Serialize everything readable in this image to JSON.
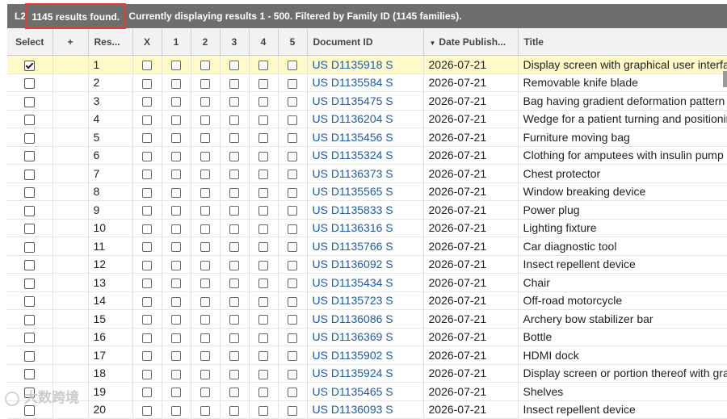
{
  "status": {
    "prefix": "L2",
    "count_text": "1145 results found.",
    "rest_text": " Currently displaying results 1 - 500. Filtered by Family ID (1145 families)."
  },
  "columns": {
    "select": "Select",
    "plus": "+",
    "result": "Res...",
    "x": "X",
    "c1": "1",
    "c2": "2",
    "c3": "3",
    "c4": "4",
    "c5": "5",
    "document_id": "Document ID",
    "date": "Date Publish...",
    "title": "Title"
  },
  "sort_icon": "sort-descending-triangle",
  "rows": [
    {
      "n": "1",
      "doc": "US D1135918 S",
      "date": "2026-07-21",
      "title": "Display screen with graphical user interface",
      "checked": true
    },
    {
      "n": "2",
      "doc": "US D1135584 S",
      "date": "2026-07-21",
      "title": "Removable knife blade",
      "checked": false
    },
    {
      "n": "3",
      "doc": "US D1135475 S",
      "date": "2026-07-21",
      "title": "Bag having gradient deformation pattern",
      "checked": false
    },
    {
      "n": "4",
      "doc": "US D1136204 S",
      "date": "2026-07-21",
      "title": "Wedge for a patient turning and positioning",
      "checked": false
    },
    {
      "n": "5",
      "doc": "US D1135456 S",
      "date": "2026-07-21",
      "title": "Furniture moving bag",
      "checked": false
    },
    {
      "n": "6",
      "doc": "US D1135324 S",
      "date": "2026-07-21",
      "title": "Clothing for amputees with insulin pump",
      "checked": false
    },
    {
      "n": "7",
      "doc": "US D1136373 S",
      "date": "2026-07-21",
      "title": "Chest protector",
      "checked": false
    },
    {
      "n": "8",
      "doc": "US D1135565 S",
      "date": "2026-07-21",
      "title": "Window breaking device",
      "checked": false
    },
    {
      "n": "9",
      "doc": "US D1135833 S",
      "date": "2026-07-21",
      "title": "Power plug",
      "checked": false
    },
    {
      "n": "10",
      "doc": "US D1136316 S",
      "date": "2026-07-21",
      "title": "Lighting fixture",
      "checked": false
    },
    {
      "n": "11",
      "doc": "US D1135766 S",
      "date": "2026-07-21",
      "title": "Car diagnostic tool",
      "checked": false
    },
    {
      "n": "12",
      "doc": "US D1136092 S",
      "date": "2026-07-21",
      "title": "Insect repellent device",
      "checked": false
    },
    {
      "n": "13",
      "doc": "US D1135434 S",
      "date": "2026-07-21",
      "title": "Chair",
      "checked": false
    },
    {
      "n": "14",
      "doc": "US D1135723 S",
      "date": "2026-07-21",
      "title": "Off-road motorcycle",
      "checked": false
    },
    {
      "n": "15",
      "doc": "US D1136086 S",
      "date": "2026-07-21",
      "title": "Archery bow stabilizer bar",
      "checked": false
    },
    {
      "n": "16",
      "doc": "US D1136369 S",
      "date": "2026-07-21",
      "title": "Bottle",
      "checked": false
    },
    {
      "n": "17",
      "doc": "US D1135902 S",
      "date": "2026-07-21",
      "title": "HDMI dock",
      "checked": false
    },
    {
      "n": "18",
      "doc": "US D1135924 S",
      "date": "2026-07-21",
      "title": "Display screen or portion thereof with graphical",
      "checked": false
    },
    {
      "n": "19",
      "doc": "US D1135465 S",
      "date": "2026-07-21",
      "title": "Shelves",
      "checked": false
    },
    {
      "n": "20",
      "doc": "US D1136093 S",
      "date": "2026-07-21",
      "title": "Insect repellent device",
      "checked": false
    }
  ],
  "watermark": "大数跨境"
}
